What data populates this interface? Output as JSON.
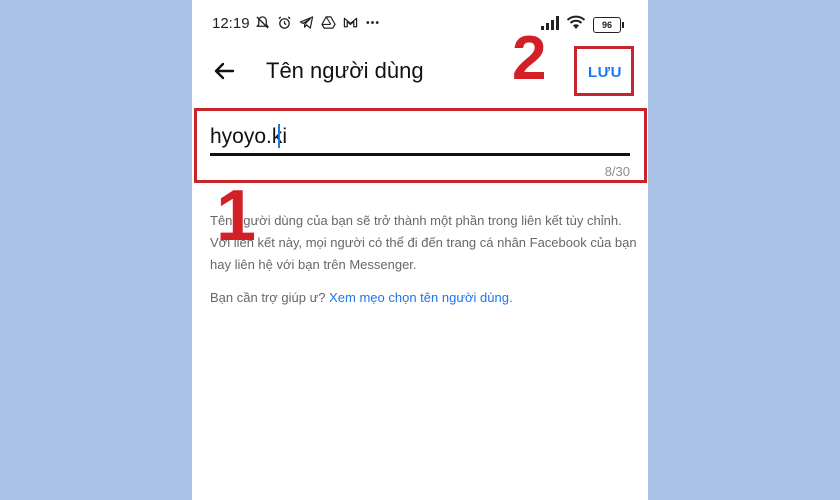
{
  "status_bar": {
    "time": "12:19",
    "left_icons": [
      "muted-bell-icon",
      "alarm-icon",
      "telegram-icon",
      "drive-icon",
      "gmail-icon",
      "more-dots-icon"
    ],
    "right_icons": [
      "signal-icon",
      "wifi-icon"
    ],
    "battery": "96"
  },
  "header": {
    "back_icon": "arrow-left-icon",
    "title": "Tên người dùng",
    "save_label": "LƯU"
  },
  "username_field": {
    "value": "hyoyo.ki",
    "counter": "8/30"
  },
  "annotations": {
    "step1": "1",
    "step2": "2",
    "highlight_color": "#c8242b"
  },
  "description": "Tên người dùng của bạn sẽ trở thành một phần trong liên kết tùy chỉnh. Với liên kết này, mọi người có thể đi đến trang cá nhân Facebook của bạn hay liên hệ với bạn trên Messenger.",
  "help": {
    "prefix": "Bạn cần trợ giúp ư? ",
    "link": "Xem mẹo chọn tên người dùng",
    "suffix": "."
  },
  "colors": {
    "accent": "#1877f2",
    "annotation_red": "#d32027",
    "background": "#a9c2e6"
  }
}
